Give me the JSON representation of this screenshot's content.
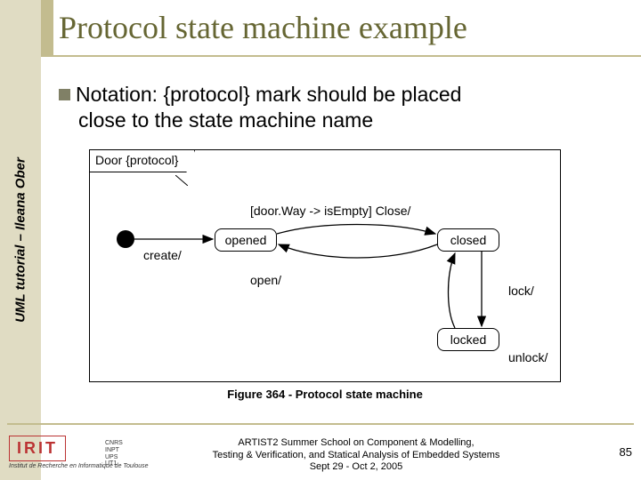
{
  "sidebar": {
    "text": "UML tutorial – Ileana Ober"
  },
  "title": "Protocol state machine example",
  "bullet": {
    "line1a": "Notation: ",
    "line1b": "{protocol}",
    "line1c": " mark should be placed",
    "line2": "close to the state machine name"
  },
  "diagram": {
    "tab": "Door {protocol}",
    "states": {
      "opened": "opened",
      "closed": "closed",
      "locked": "locked"
    },
    "labels": {
      "create": "create/",
      "guard": "[door.Way -> isEmpty] Close/",
      "open": "open/",
      "lock": "lock/",
      "unlock": "unlock/"
    },
    "caption": "Figure 364 - Protocol state machine"
  },
  "footer": {
    "line1": "ARTIST2 Summer School on Component & Modelling,",
    "line2": "Testing & Verification, and Statical Analysis of Embedded Systems",
    "line3": "Sept 29 - Oct 2, 2005",
    "page": "85",
    "logo_sub": "Institut de Recherche en Informatique de Toulouse",
    "affil": {
      "a": "CNRS",
      "b": "INPT",
      "c": "UPS",
      "d": "UT1"
    }
  }
}
